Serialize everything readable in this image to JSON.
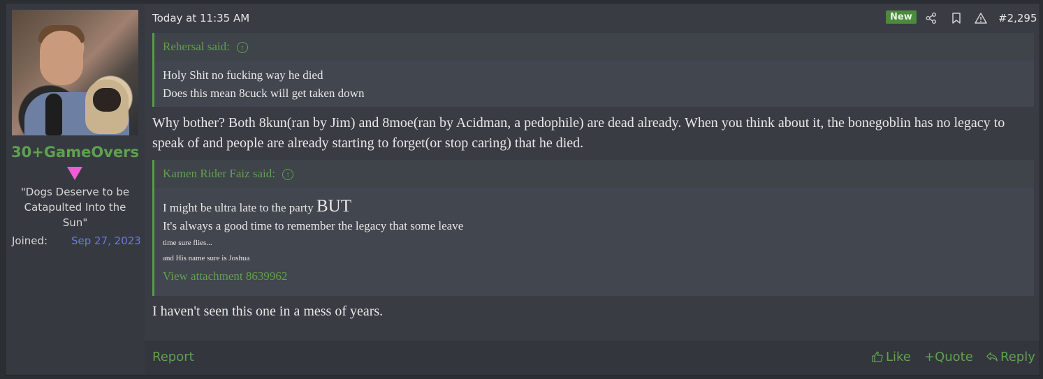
{
  "user": {
    "username": "30+GameOvers",
    "title": "\"Dogs Deserve to be Catapulted Into the Sun\"",
    "joined_label": "Joined:",
    "joined_value": "Sep 27, 2023"
  },
  "header": {
    "timestamp": "Today at 11:35 AM",
    "badge": "New",
    "post_number": "#2,295"
  },
  "quote1": {
    "author": "Rehersal said:",
    "lines": [
      "Holy Shit no fucking way he died",
      "Does this mean 8cuck will get taken down"
    ]
  },
  "body": {
    "main_text": "Why bother? Both 8kun(ran by Jim) and 8moe(ran by Acidman, a pedophile) are dead already. When you think about it, the bonegoblin has no legacy to speak of and people are already starting to forget(or stop caring) that he died.",
    "final_text": "I haven't seen this one in a mess of years."
  },
  "quote2": {
    "author": "Kamen Rider Faiz said:",
    "line1_start": "I might be ultra late to the party ",
    "line1_big": "BUT",
    "line2": "It's always a good time to remember the legacy that some leave",
    "line3": "time sure flies...",
    "line4": "and His name sure is Joshua",
    "attachment": "View attachment 8639962"
  },
  "footer": {
    "report": "Report",
    "like": "Like",
    "quote": "Quote",
    "reply": "Reply"
  },
  "colors": {
    "accent_green": "#5fa14f",
    "link_blue": "#6c79d8",
    "gender_pink": "#f25cd3"
  },
  "icons": [
    "share-icon",
    "bookmark-icon",
    "warning-icon",
    "arrow-up-icon",
    "thumbs-up-icon",
    "plus-icon",
    "reply-icon"
  ]
}
